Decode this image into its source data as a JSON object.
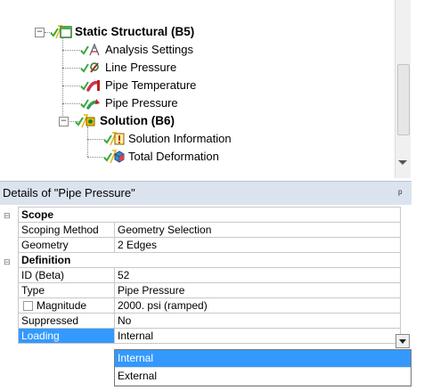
{
  "tree": {
    "nodes": [
      {
        "label": "Static Structural (B5)",
        "icon": "static-structural-icon",
        "expander": "−"
      },
      {
        "label": "Analysis Settings",
        "icon": "analysis-settings-icon"
      },
      {
        "label": "Line Pressure",
        "icon": "line-pressure-icon"
      },
      {
        "label": "Pipe Temperature",
        "icon": "pipe-temperature-icon"
      },
      {
        "label": "Pipe Pressure",
        "icon": "pipe-pressure-icon"
      },
      {
        "label": "Solution (B6)",
        "icon": "solution-icon",
        "expander": "−"
      },
      {
        "label": "Solution Information",
        "icon": "solution-information-icon"
      },
      {
        "label": "Total Deformation",
        "icon": "total-deformation-icon"
      }
    ]
  },
  "details": {
    "title": "Details of \"Pipe Pressure\"",
    "pin": "ᵖ",
    "groups": {
      "scope": "Scope",
      "definition": "Definition"
    },
    "rows": {
      "scoping_method": {
        "label": "Scoping Method",
        "value": "Geometry Selection"
      },
      "geometry": {
        "label": "Geometry",
        "value": "2 Edges"
      },
      "id": {
        "label": "ID (Beta)",
        "value": "52"
      },
      "type": {
        "label": "Type",
        "value": "Pipe Pressure"
      },
      "magnitude": {
        "label": "Magnitude",
        "value": "2000. psi  (ramped)"
      },
      "suppressed": {
        "label": "Suppressed",
        "value": "No"
      },
      "loading": {
        "label": "Loading",
        "value": "Internal"
      }
    },
    "loading_options": [
      "Internal",
      "External"
    ],
    "selected_option": "Internal"
  },
  "colors": {
    "selection": "#3399ff",
    "header": "#dbe3ef",
    "check": "#3aa83a"
  }
}
